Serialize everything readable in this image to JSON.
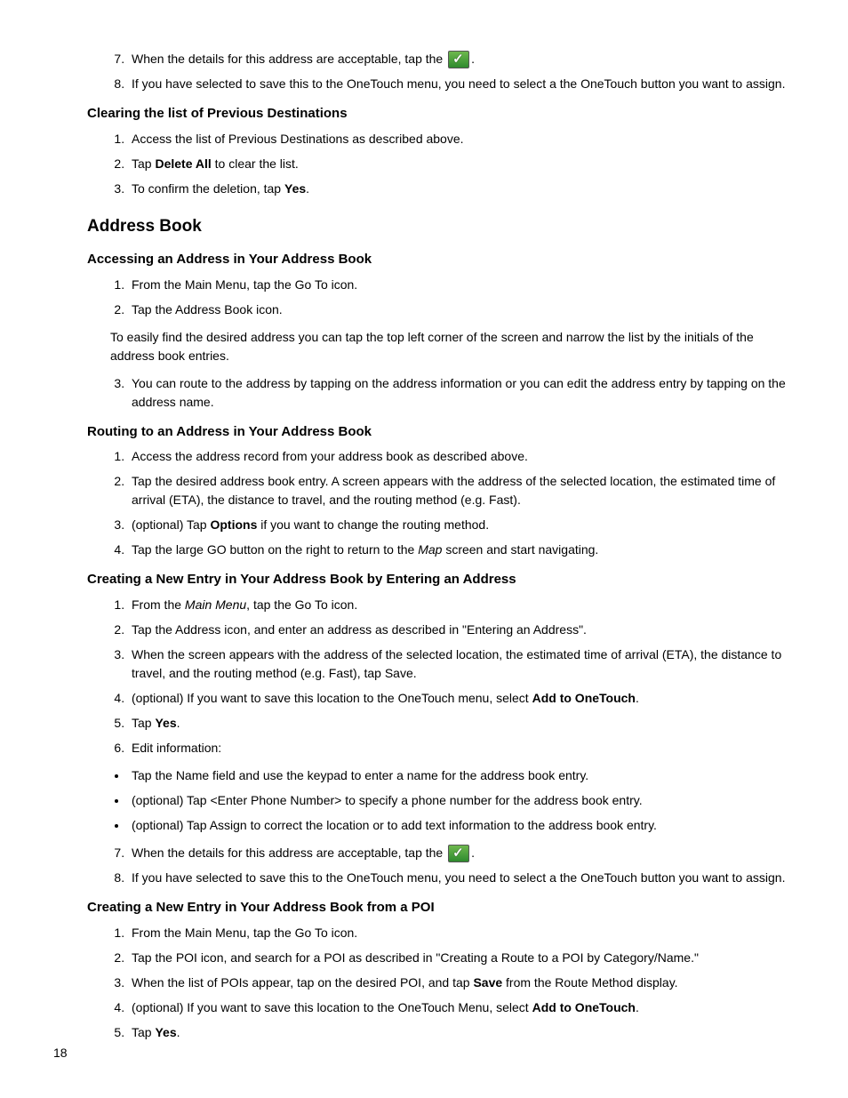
{
  "topSteps": {
    "s7_a": "When the details for this address are acceptable, tap the ",
    "s7_b": ".",
    "s8": "If you have selected to save this to the OneTouch menu, you need to select a the OneTouch button you want to assign."
  },
  "clearing": {
    "heading": "Clearing the list of Previous Destinations",
    "s1": "Access the list of Previous Destinations as described above.",
    "s2a": "Tap ",
    "s2b": "Delete All",
    "s2c": " to clear the list.",
    "s3a": "To confirm the deletion, tap ",
    "s3b": "Yes",
    "s3c": "."
  },
  "addressBook": {
    "heading": "Address Book"
  },
  "accessing": {
    "heading": "Accessing an Address in Your Address Book",
    "s1": "From the Main Menu, tap the Go To icon.",
    "s2": "Tap the Address Book icon.",
    "note": "To easily find the desired address you can tap the top left corner of the screen and narrow the list by the initials of the address book entries.",
    "s3": "You can route to the address by tapping on the address information or you can edit the address entry by tapping on the address name."
  },
  "routing": {
    "heading": "Routing to an Address in Your Address Book",
    "s1": "Access the address record from your address book as described above.",
    "s2": "Tap the desired address book entry. A screen appears with the address of the selected location, the estimated time of arrival (ETA), the distance to travel, and the routing method (e.g. Fast).",
    "s3a": "(optional) Tap ",
    "s3b": "Options",
    "s3c": " if you want to change the routing method.",
    "s4a": "Tap the large GO button on the right to return to the ",
    "s4b": "Map",
    "s4c": " screen and start navigating."
  },
  "creatingAddr": {
    "heading": "Creating a New Entry in Your Address Book by Entering an Address",
    "s1a": "From the ",
    "s1b": "Main Menu",
    "s1c": ", tap the Go To icon.",
    "s2": "Tap the Address icon, and enter an address as described in \"Entering an Address\".",
    "s3": "When the screen appears with the address of the selected location, the estimated time of arrival (ETA), the distance to travel, and the routing method (e.g. Fast), tap Save.",
    "s4a": "(optional) If you want to save this location to the OneTouch menu, select ",
    "s4b": "Add to OneTouch",
    "s4c": ".",
    "s5a": "Tap ",
    "s5b": "Yes",
    "s5c": ".",
    "s6": "Edit information:",
    "b1": "Tap the Name field and use the keypad to enter a name for the address book entry.",
    "b2": "(optional) Tap <Enter Phone Number> to specify a phone number for the address book entry.",
    "b3": "(optional) Tap Assign to correct the location or to add text information to the address book entry.",
    "s7a": "When the details for this address are acceptable, tap the ",
    "s7b": ".",
    "s8": "If you have selected to save this to the OneTouch menu, you need to select a the OneTouch button you want to assign."
  },
  "creatingPOI": {
    "heading": "Creating a New Entry in Your Address Book from a POI",
    "s1": "From the Main Menu, tap the Go To icon.",
    "s2": "Tap the POI icon, and search for a POI as described in \"Creating a Route to a POI by Category/Name.\"",
    "s3a": "When the list of POIs appear, tap on the desired POI, and tap ",
    "s3b": "Save",
    "s3c": " from the Route Method display.",
    "s4a": "(optional) If you want to save this location to the OneTouch Menu, select ",
    "s4b": "Add to OneTouch",
    "s4c": ".",
    "s5a": "Tap ",
    "s5b": "Yes",
    "s5c": "."
  },
  "pageNumber": "18"
}
